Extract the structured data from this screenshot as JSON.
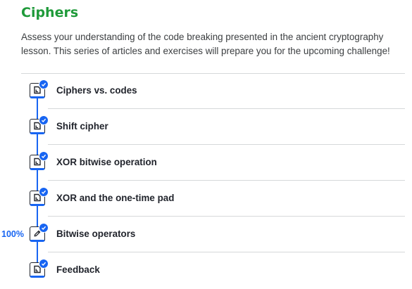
{
  "page": {
    "title": "Ciphers",
    "description": "Assess your understanding of the code breaking presented in the ancient cryptography lesson. This series of articles and exercises will prepare you for the upcoming challenge!"
  },
  "items": [
    {
      "label": "Ciphers vs. codes",
      "type": "article",
      "icon": "article-icon",
      "completed": true
    },
    {
      "label": "Shift cipher",
      "type": "article",
      "icon": "article-icon",
      "completed": true
    },
    {
      "label": "XOR bitwise operation",
      "type": "article",
      "icon": "article-icon",
      "completed": true
    },
    {
      "label": "XOR and the one-time pad",
      "type": "article",
      "icon": "article-icon",
      "completed": true
    },
    {
      "label": "Bitwise operators",
      "type": "exercise",
      "icon": "pencil-icon",
      "completed": true,
      "progress": "100%"
    },
    {
      "label": "Feedback",
      "type": "article",
      "icon": "article-icon",
      "completed": true
    }
  ],
  "colors": {
    "title": "#1f9a3a",
    "accent": "#1865f2",
    "text": "#21242c",
    "divider": "#d6d8da"
  }
}
